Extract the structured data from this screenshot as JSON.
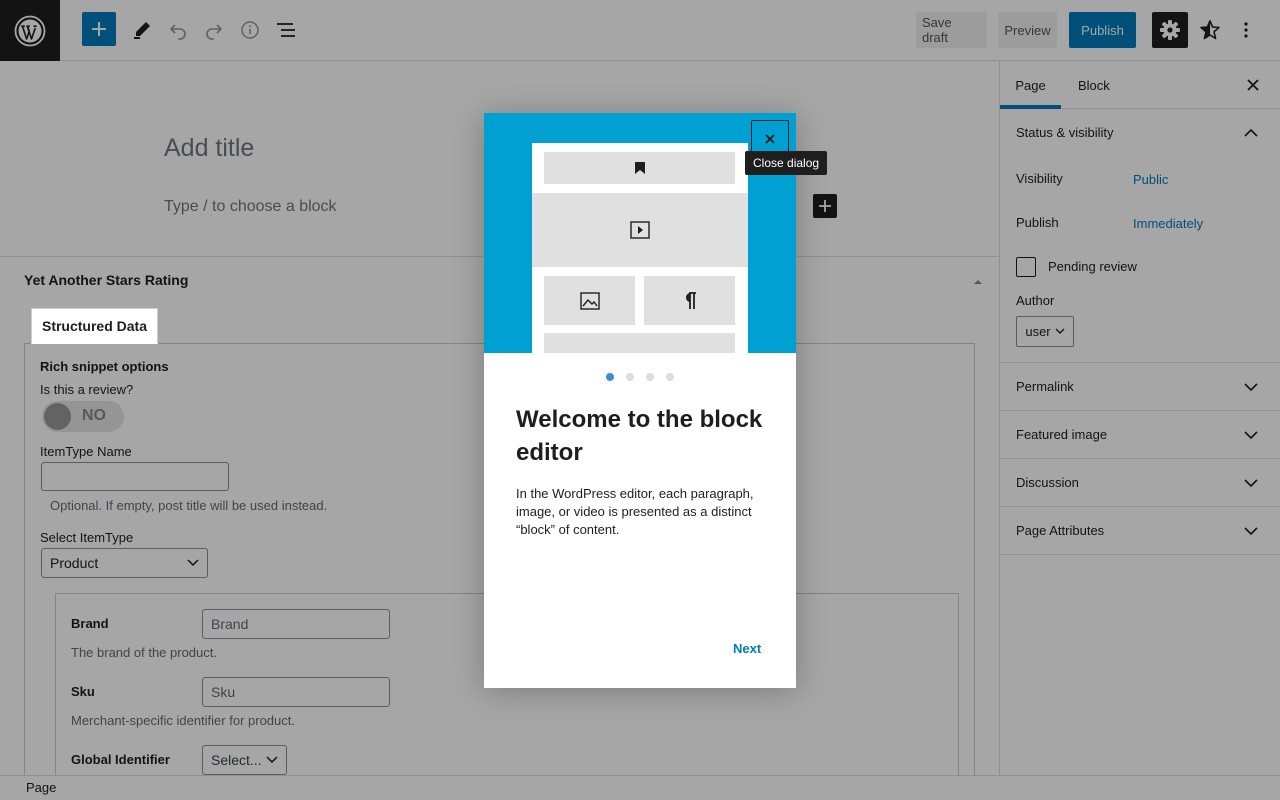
{
  "toolbar": {
    "save_draft": "Save draft",
    "preview": "Preview",
    "publish": "Publish"
  },
  "editor": {
    "title_placeholder": "Add title",
    "block_placeholder": "Type / to choose a block"
  },
  "metabox": {
    "title": "Yet Another Stars Rating",
    "tab": "Structured Data",
    "rich_snippet_options": "Rich snippet options",
    "is_review_label": "Is this a review?",
    "toggle_value": "NO",
    "itemtype_name_label": "ItemType Name",
    "itemtype_name_value": "",
    "itemtype_name_help": "Optional. If empty, post title will be used instead.",
    "select_itemtype_label": "Select ItemType",
    "select_itemtype_value": "Product",
    "brand_label": "Brand",
    "brand_placeholder": "Brand",
    "brand_help": "The brand of the product.",
    "sku_label": "Sku",
    "sku_placeholder": "Sku",
    "sku_help": "Merchant-specific identifier for product.",
    "global_id_label": "Global Identifier",
    "global_id_value": "Select..."
  },
  "sidebar": {
    "tabs": [
      "Page",
      "Block"
    ],
    "status_section": "Status & visibility",
    "visibility_label": "Visibility",
    "visibility_value": "Public",
    "publish_label": "Publish",
    "publish_value": "Immediately",
    "pending_review": "Pending review",
    "author_label": "Author",
    "author_value": "user",
    "sections": [
      "Permalink",
      "Featured image",
      "Discussion",
      "Page Attributes"
    ]
  },
  "footer": {
    "breadcrumb": "Page"
  },
  "modal": {
    "close_tooltip": "Close dialog",
    "heading": "Welcome to the block editor",
    "text": "In the WordPress editor, each paragraph, image, or video is presented as a distinct “block” of content.",
    "next": "Next",
    "page_count": 4,
    "current_page": 1
  },
  "colors": {
    "accent": "#007cba",
    "modal_image_bg": "#00a0d2",
    "dark": "#1e1e1e"
  }
}
